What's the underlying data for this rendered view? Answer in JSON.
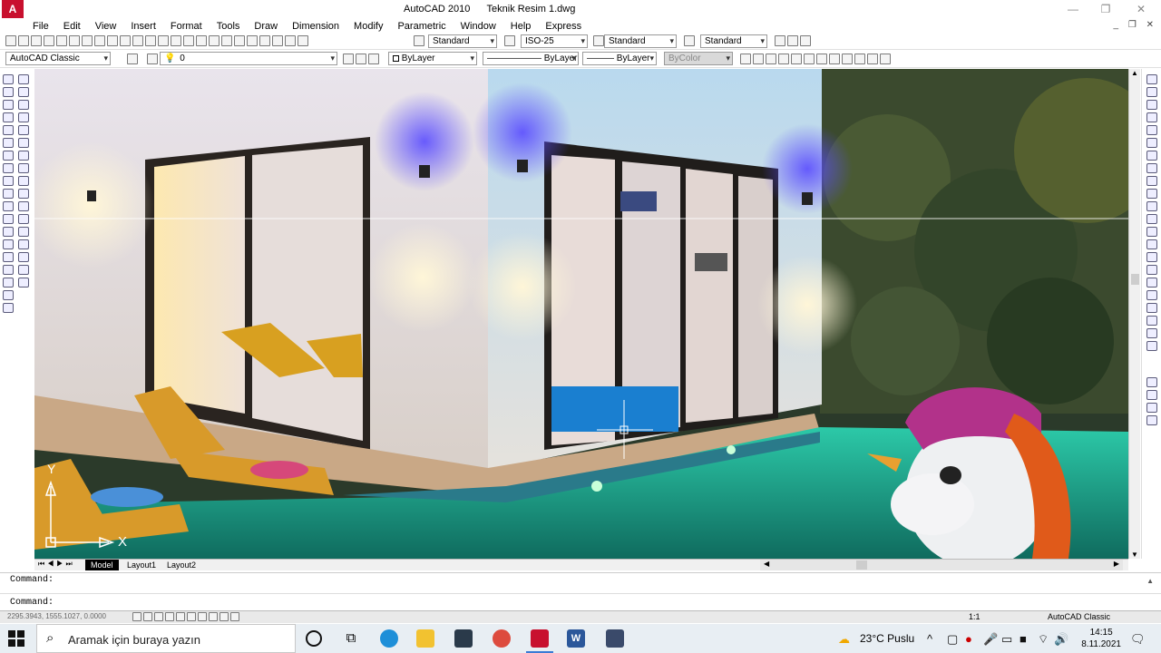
{
  "window": {
    "app_title": "AutoCAD 2010",
    "document_title": "Teknik Resim 1.dwg",
    "app_logo_letter": "A"
  },
  "menu": [
    "File",
    "Edit",
    "View",
    "Insert",
    "Format",
    "Tools",
    "Draw",
    "Dimension",
    "Modify",
    "Parametric",
    "Window",
    "Help",
    "Express"
  ],
  "toolbar1": {
    "text_style": "Standard",
    "dim_style": "ISO-25",
    "table_style": "Standard",
    "multileader_style": "Standard"
  },
  "toolbar2": {
    "workspace": "AutoCAD Classic",
    "layer": "0",
    "color": "ByLayer",
    "linetype": "ByLayer",
    "lineweight": "ByLayer",
    "plot_style": "ByColor"
  },
  "tabs": [
    "Model",
    "Layout1",
    "Layout2"
  ],
  "ucs": {
    "y_label": "Y",
    "x_label": "X"
  },
  "command": {
    "line1": "Command:",
    "line2": "Command:"
  },
  "status": {
    "coords": "2295.3943, 1555.1027, 0.0000",
    "annotation_scale": "1:1",
    "workspace": "AutoCAD Classic"
  },
  "taskbar": {
    "search_placeholder": "Aramak için buraya yazın",
    "weather": "23°C  Puslu",
    "time": "14:15",
    "date": "8.11.2021"
  },
  "colors": {
    "autocad_red": "#c8102e",
    "taskbar_bg": "#e8eef3",
    "pool_water": "#1fb59c",
    "wall_white": "#f2ece6"
  }
}
